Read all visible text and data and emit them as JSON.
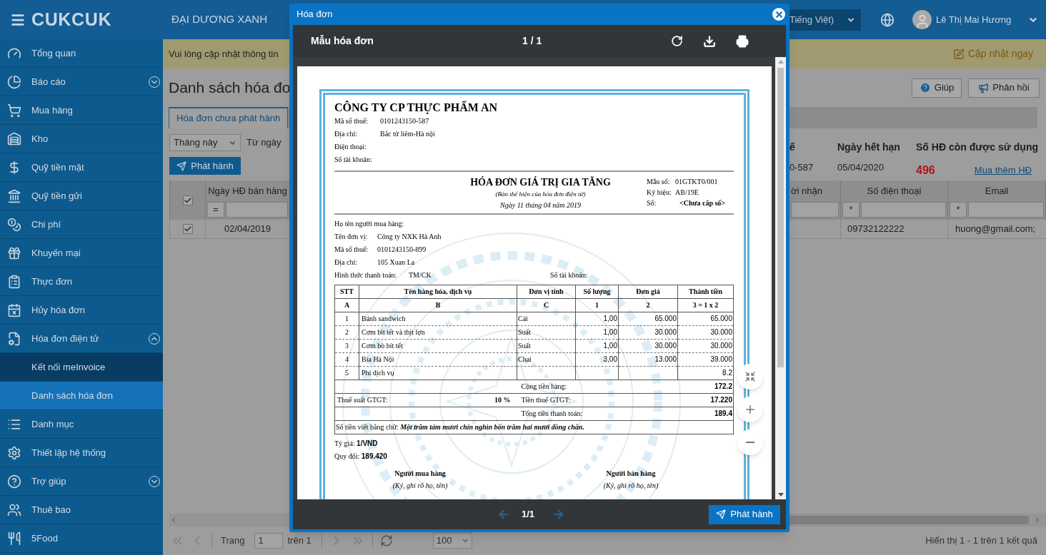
{
  "app": {
    "logo": "CUKCUK",
    "company": "ĐẠI DƯƠNG XANH",
    "language": "Tiếng Việt)",
    "user": "Lê Thị Mai Hương"
  },
  "sidebar": {
    "items": [
      {
        "label": "Tổng quan",
        "selected": false
      },
      {
        "label": "Báo cáo",
        "selected": false,
        "expanded": false
      },
      {
        "label": "Mua hàng",
        "selected": false
      },
      {
        "label": "Kho",
        "selected": false
      },
      {
        "label": "Quỹ tiền mặt",
        "selected": false
      },
      {
        "label": "Quỹ tiền gửi",
        "selected": false
      },
      {
        "label": "Chi phí",
        "selected": false
      },
      {
        "label": "Khuyến mại",
        "selected": false
      },
      {
        "label": "Thực đơn",
        "selected": false
      },
      {
        "label": "Hủy hóa đơn",
        "selected": false
      },
      {
        "label": "Hóa đơn điện tử",
        "selected": false,
        "expanded": true,
        "children": [
          {
            "label": "Kết nối meInvoice",
            "selected": false
          },
          {
            "label": "Danh sách hóa đơn",
            "selected": true
          }
        ]
      },
      {
        "label": "Danh mục",
        "selected": false
      },
      {
        "label": "Thiết lập hệ thống",
        "selected": false
      },
      {
        "label": "Trợ giúp",
        "selected": false,
        "expanded": false
      },
      {
        "label": "Thuê bao",
        "selected": false
      },
      {
        "label": "5Food",
        "selected": false
      }
    ]
  },
  "notice": {
    "text": "Vui lòng cập nhật thông tin",
    "action": "Cập nhật ngay"
  },
  "page": {
    "title": "Danh sách hóa đơ",
    "help": "Giúp",
    "feedback": "Phản hồi",
    "tabs": [
      {
        "label": "Hóa đơn chưa phát hành",
        "selected": true
      }
    ],
    "period": "Tháng này",
    "from_label": "Từ ngày",
    "issue_button": "Phát hành",
    "summary": {
      "labels": [
        "ế",
        "Ngày hết hạn",
        "Số HĐ còn được sử dụng"
      ],
      "values": [
        "0-587",
        "05/04/2020",
        "496"
      ],
      "link": "Mua thêm HĐ"
    },
    "table": {
      "header_checked": true,
      "left_column": "Ngày HĐ bán hàng",
      "left_filter": "=",
      "right_columns": [
        "ời nhận",
        "Số điện thoại",
        "Email"
      ],
      "right_filters": [
        "*",
        "*"
      ],
      "rows": [
        {
          "checked": true,
          "date": "02/04/2019",
          "phone": "09732122222",
          "email": "huong@gmail.com;"
        }
      ]
    },
    "pager": {
      "page_label": "Trang",
      "page": "1",
      "of": "trên 1",
      "size": "100",
      "summary": "Hiển thị 1 - 1 trên 1 kết quả"
    }
  },
  "dialog": {
    "title": "Hóa đơn",
    "document": "Mẫu hóa đơn",
    "pages": "1 / 1",
    "footer_page": "1/1",
    "footer_button": "Phát hành",
    "invoice": {
      "seller": "CÔNG TY CP THỰC PHẨM AN",
      "seller_fields": [
        {
          "label": "Mã số thuế:",
          "value": "0101243150-587"
        },
        {
          "label": "Địa chỉ:",
          "value": "Bắc từ liêm-Hà nội"
        },
        {
          "label": "Điện thoại:"
        },
        {
          "label": "Số tài khoản:"
        }
      ],
      "title": "HÓA ĐƠN GIÁ TRỊ GIA TĂNG",
      "subtitle": "(Bản thể hiện của hóa đơn điện tử)",
      "date": "Ngày 11 tháng 04 năm 2019",
      "meta": [
        {
          "label": "Mẫu số:",
          "value": "01GTKT0/001"
        },
        {
          "label": "Ký hiệu:",
          "value": "AB/19E"
        },
        {
          "label": "Số:",
          "value": "<Chưa cấp số>"
        }
      ],
      "buyer_fields": [
        {
          "label": "Họ tên người mua hàng:"
        },
        {
          "label": "Tên đơn vị:",
          "value": "Công ty NXK Hà Anh"
        },
        {
          "label": "Mã số thuế:",
          "value": "0101243150-899"
        },
        {
          "label": "Địa chỉ:",
          "value": "105 Xuan La"
        },
        {
          "label": "Hình thức thanh toán:",
          "value": "TM/CK"
        }
      ],
      "account_label": "Số tài khoản:",
      "columns": [
        "STT",
        "Tên hàng hóa, dịch vụ",
        "Đơn vị tính",
        "Số lượng",
        "Đơn giá",
        "Thành tiền"
      ],
      "column_codes": [
        "A",
        "B",
        "C",
        "1",
        "2",
        "3 = 1 x 2"
      ],
      "rows": [
        {
          "no": "1",
          "name": "Bánh sandwich",
          "unit": "Cái",
          "qty": "1,00",
          "price": "65.000",
          "amount": "65.000"
        },
        {
          "no": "2",
          "name": "Cơm bít tết và thịt lợn",
          "unit": "Suất",
          "qty": "1,00",
          "price": "30.000",
          "amount": "30.000"
        },
        {
          "no": "3",
          "name": "Cơm bò bít tết",
          "unit": "Suất",
          "qty": "1,00",
          "price": "30.000",
          "amount": "30.000"
        },
        {
          "no": "4",
          "name": "Bia Hà Nội",
          "unit": "Chai",
          "qty": "3,00",
          "price": "13.000",
          "amount": "39.000"
        },
        {
          "no": "5",
          "name": "Phí dịch vụ",
          "amount": "8.2"
        }
      ],
      "subtotal": {
        "label": "Cộng tiền hàng:",
        "value": "172.2"
      },
      "tax_rate": {
        "label": "Thuế suất GTGT:",
        "value": "10 %"
      },
      "tax": {
        "label": "Tiền thuế GTGT:",
        "value": "17.220"
      },
      "total": {
        "label": "Tổng tiền thanh toán:",
        "value": "189.4"
      },
      "in_words": {
        "label": "Số tiền viết bằng chữ:",
        "value": "Một trăm tám mươi chín nghìn bốn trăm hai mươi đồng chẵn."
      },
      "exchange": [
        "Tỷ giá: **1/VND**",
        "Quy đổi: **189.420**"
      ],
      "signatures": [
        {
          "title": "Người mua hàng",
          "note": "(Ký, ghi rõ họ, tên)"
        },
        {
          "title": "Người bán hàng",
          "note": "(Ký, ghi rõ họ, tên)"
        }
      ]
    }
  }
}
